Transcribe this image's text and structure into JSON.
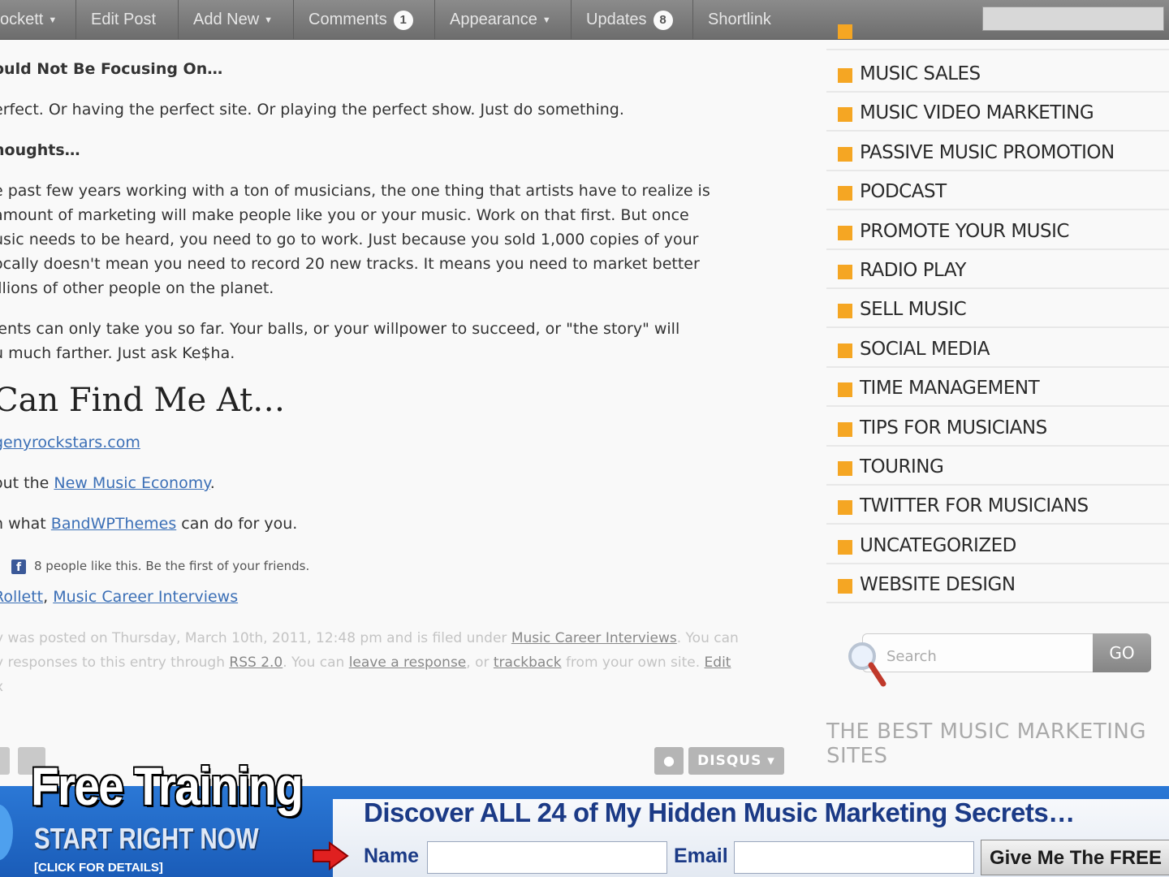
{
  "admin_bar": {
    "items": [
      {
        "label": "ockett",
        "caret": true
      },
      {
        "label": "Edit Post"
      },
      {
        "label": "Add New",
        "caret": true
      },
      {
        "label": "Comments",
        "count": "1"
      },
      {
        "label": "Appearance",
        "caret": true
      },
      {
        "label": "Updates",
        "count": "8"
      },
      {
        "label": "Shortlink"
      }
    ]
  },
  "post": {
    "subheading_1": "ould Not Be Focusing On…",
    "para_1": "erfect. Or having the perfect site. Or playing the perfect show. Just do something.",
    "subheading_2": "houghts…",
    "para_2_lines": [
      "e past few years working with a ton of musicians, the one thing that artists have to realize is",
      " amount of marketing will make people like you or your music. Work on that first. But once",
      "usic needs to be heard, you need to go to work. Just because you sold 1,000 copies of your",
      "ocally doesn't mean you need to record 20 new tracks. It means you need to market better",
      "illions of other people on the planet."
    ],
    "para_3_lines": [
      "lents can only take you so far. Your balls, or your willpower to succeed, or \"the story\" will",
      "u much farther. Just ask Ke$ha."
    ],
    "heading": " Can Find Me At…",
    "link_site": "genyrockstars.com",
    "line_economy_prefix": "out the ",
    "link_economy": "New Music Economy",
    "line_economy_suffix": ".",
    "line_themes_prefix": "h what ",
    "link_themes": "BandWPThemes",
    "line_themes_suffix": " can do for you.",
    "fb_text": "8 people like this. Be the first of your friends.",
    "tag_1": " Rollett",
    "tag_2": "Music Career Interviews",
    "meta_line_1_a": "y was posted on Thursday, March 10th, 2011, 12:48 pm and is filed under ",
    "meta_line_1_link": "Music Career Interviews",
    "meta_line_1_b": ". You can",
    "meta_line_2_a": "y responses to this entry through ",
    "meta_rss": "RSS 2.0",
    "meta_line_2_b": ". You can ",
    "meta_leave": "leave a response",
    "meta_line_2_c": ", or ",
    "meta_trackback": "trackback",
    "meta_line_2_d": " from your own site. ",
    "meta_edit": "Edit",
    "meta_line_3": "x",
    "disqus_label": "DISQUS",
    "disqus_caret": "▾"
  },
  "sidebar": {
    "categories": [
      "MUSIC SALES",
      "MUSIC VIDEO MARKETING",
      "PASSIVE MUSIC PROMOTION",
      "PODCAST",
      "PROMOTE YOUR MUSIC",
      "RADIO PLAY",
      "SELL MUSIC",
      "SOCIAL MEDIA",
      "TIME MANAGEMENT",
      "TIPS FOR MUSICIANS",
      "TOURING",
      "TWITTER FOR MUSICIANS",
      "UNCATEGORIZED",
      "WEBSITE DESIGN"
    ],
    "search_placeholder": "Search",
    "search_button": "GO",
    "heading": "THE BEST MUSIC MARKETING SITES"
  },
  "banner": {
    "headline": "Free Training",
    "subline": "START RIGHT NOW",
    "small": "[CLICK FOR DETAILS]",
    "discover": "Discover ALL 24 of My Hidden Music Marketing Secrets…",
    "name_label": "Name",
    "email_label": "Email",
    "submit_label": "Give Me The FREE"
  },
  "colors": {
    "admin_bar": "#7a7a7a",
    "category_square": "#f5a623",
    "link": "#3b6fb6",
    "banner_blue": "#1a5cb8",
    "banner_text": "#1b3a86"
  }
}
